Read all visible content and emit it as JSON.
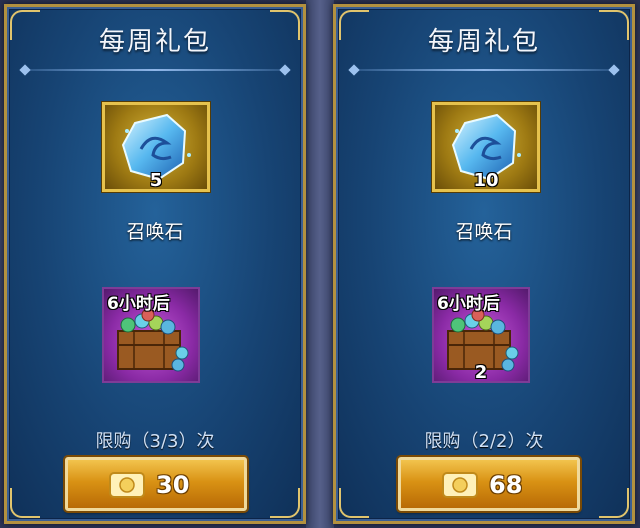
{
  "colors": {
    "frame_gold": "#b3913f",
    "panel_blue": "#174474",
    "button_orange": "#d99214",
    "item_purple": "#8a2aa5"
  },
  "packs": [
    {
      "title": "每周礼包",
      "summon_stone": {
        "name": "召唤石",
        "quantity": "5"
      },
      "chest": {
        "timer": "6小时后",
        "quantity": ""
      },
      "limit": "限购（3/3）次",
      "price": "30"
    },
    {
      "title": "每周礼包",
      "summon_stone": {
        "name": "召唤石",
        "quantity": "10"
      },
      "chest": {
        "timer": "6小时后",
        "quantity": "2"
      },
      "limit": "限购（2/2）次",
      "price": "68"
    }
  ]
}
